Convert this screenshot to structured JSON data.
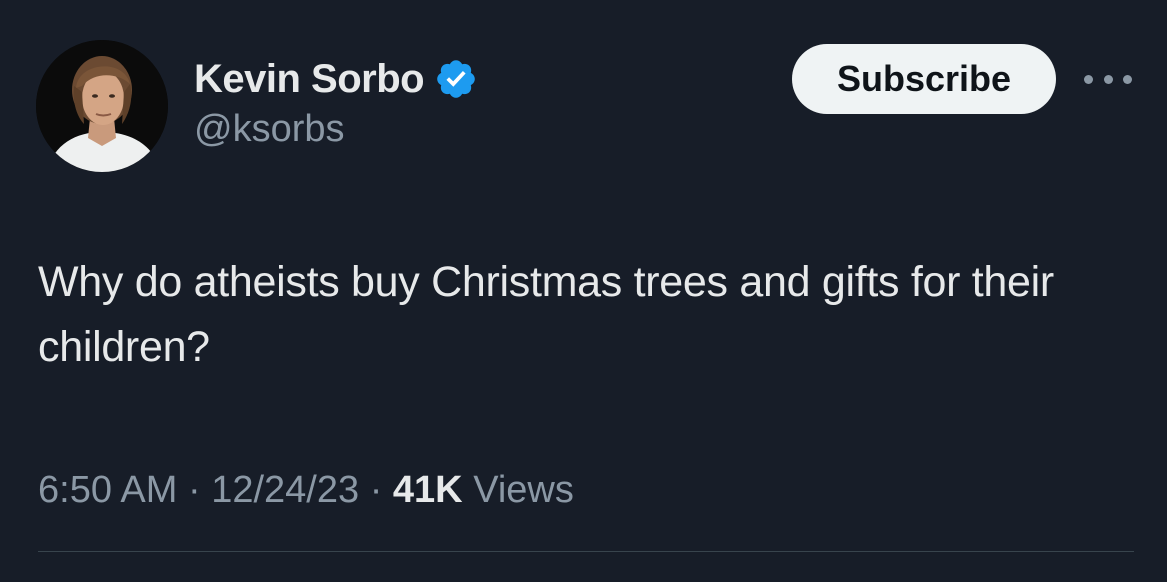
{
  "author": {
    "display_name": "Kevin Sorbo",
    "handle": "@ksorbs",
    "verified_icon": "verified-badge-icon",
    "avatar": "profile-photo"
  },
  "actions": {
    "subscribe_label": "Subscribe",
    "more_icon": "more-horizontal-icon"
  },
  "tweet": {
    "text": "Why do atheists buy Christmas trees and gifts for their children?"
  },
  "meta": {
    "time": "6:50 AM",
    "separator": "·",
    "date": "12/24/23",
    "views_count": "41K",
    "views_label": "Views"
  },
  "colors": {
    "background": "#171d28",
    "primary_text": "#e7e9ea",
    "secondary_text": "#8b98a5",
    "verified_blue": "#1d9bf0",
    "button_bg": "#eff3f4"
  }
}
